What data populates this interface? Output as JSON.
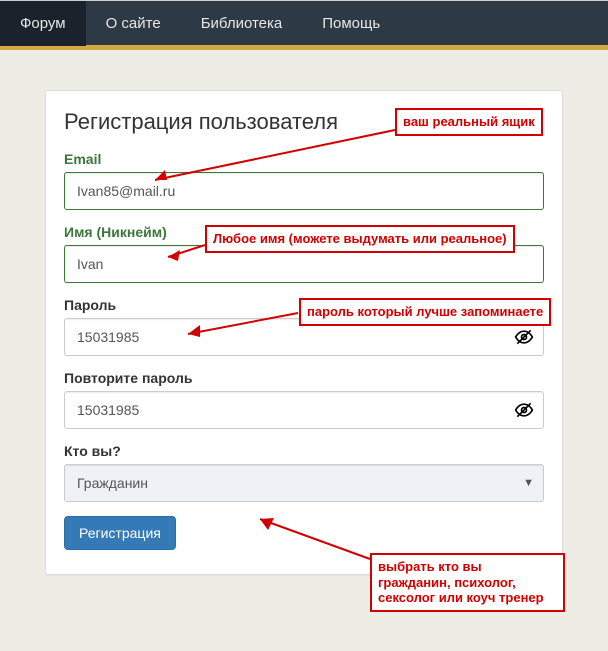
{
  "nav": {
    "items": [
      "Форум",
      "О сайте",
      "Библиотека",
      "Помощь"
    ]
  },
  "form": {
    "title": "Регистрация пользователя",
    "email_label": "Email",
    "email_value": "Ivan85@mail.ru",
    "name_label": "Имя (Никнейм)",
    "name_value": "Ivan",
    "password_label": "Пароль",
    "password_value": "15031985",
    "confirm_label": "Повторите пароль",
    "confirm_value": "15031985",
    "who_label": "Кто вы?",
    "who_value": "Гражданин",
    "submit_label": "Регистрация"
  },
  "annotations": {
    "email": "ваш реальный ящик",
    "name": "Любое имя (можете выдумать или реальное)",
    "password": "пароль который лучше запоминаете",
    "who": "выбрать кто вы гражданин, психолог, сексолог или коуч тренер"
  }
}
